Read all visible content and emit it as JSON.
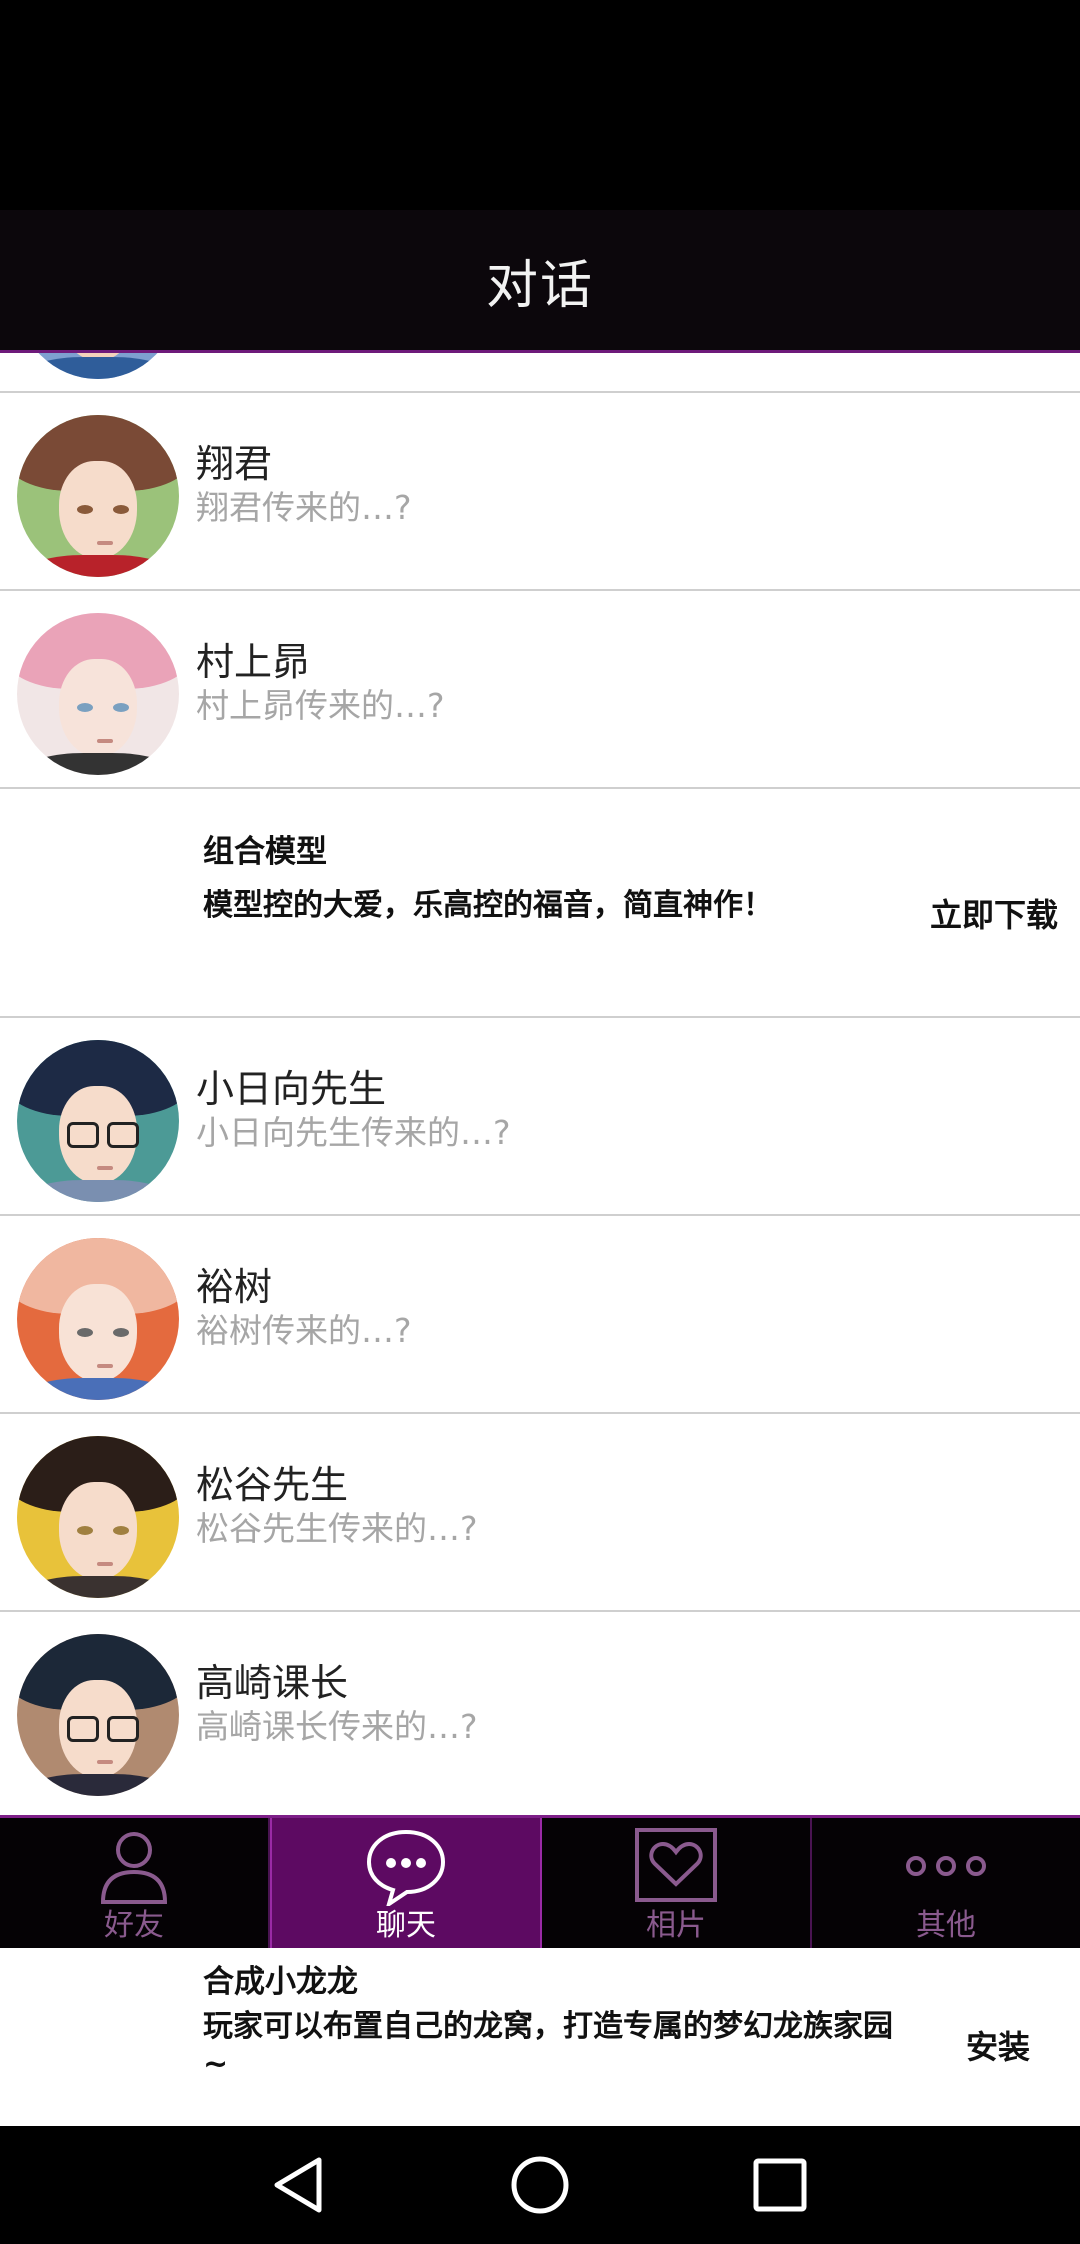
{
  "header": {
    "title": "对话"
  },
  "contacts": [
    {
      "name": "",
      "preview": ""
    },
    {
      "name": "翔君",
      "preview": "翔君传来的…?"
    },
    {
      "name": "村上昴",
      "preview": "村上昴传来的…?"
    },
    {
      "name": "小日向先生",
      "preview": "小日向先生传来的…?"
    },
    {
      "name": "裕树",
      "preview": "裕树传来的…?"
    },
    {
      "name": "松谷先生",
      "preview": "松谷先生传来的…?"
    },
    {
      "name": "高崎课长",
      "preview": "高崎课长传来的…?"
    }
  ],
  "ad_inline": {
    "title": "组合模型",
    "desc": "模型控的大爱，乐高控的福音，简直神作！",
    "button": "立即下载"
  },
  "tabs": [
    {
      "label": "好友",
      "icon": "person-icon",
      "active": false
    },
    {
      "label": "聊天",
      "icon": "chat-bubble-icon",
      "active": true
    },
    {
      "label": "相片",
      "icon": "heart-photo-icon",
      "active": false
    },
    {
      "label": "其他",
      "icon": "more-dots-icon",
      "active": false
    }
  ],
  "ad_bottom": {
    "title": "合成小龙龙",
    "desc": "玩家可以布置自己的龙窝，打造专属的梦幻龙族家园~",
    "button": "安装"
  },
  "navbar": {
    "icons": [
      "back-icon",
      "home-icon",
      "recents-icon"
    ]
  },
  "colors": {
    "header_bg": "#0c070c",
    "accent": "#7d1f88",
    "active_tab": "#5d0a62"
  }
}
